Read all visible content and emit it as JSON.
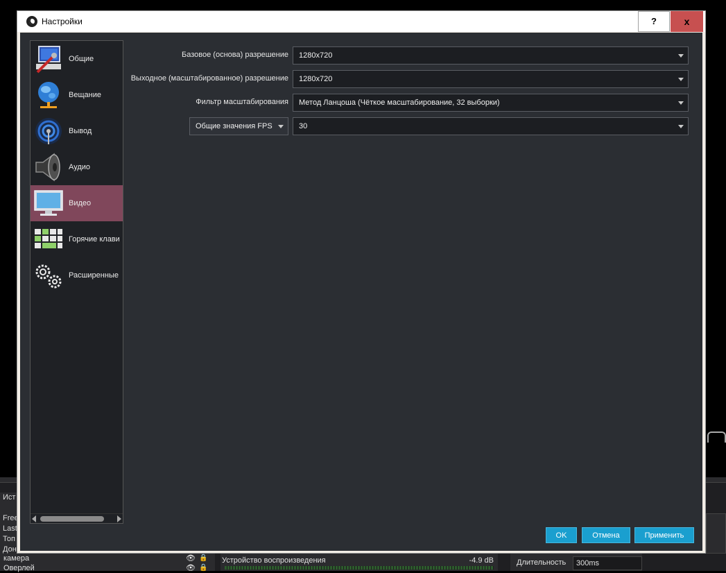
{
  "window": {
    "title": "Настройки",
    "help_label": "?",
    "close_label": "x"
  },
  "sidebar": {
    "items": [
      {
        "label": "Общие",
        "icon": "general-icon"
      },
      {
        "label": "Вещание",
        "icon": "globe-icon"
      },
      {
        "label": "Вывод",
        "icon": "output-signal-icon"
      },
      {
        "label": "Аудио",
        "icon": "speaker-icon"
      },
      {
        "label": "Видео",
        "icon": "monitor-icon",
        "active": true
      },
      {
        "label": "Горячие клави",
        "icon": "keyboard-icon"
      },
      {
        "label": "Расширенные",
        "icon": "gears-icon"
      }
    ]
  },
  "video": {
    "base_resolution_label": "Базовое (основа) разрешение",
    "base_resolution_value": "1280x720",
    "output_resolution_label": "Выходное (масштабированное) разрешение",
    "output_resolution_value": "1280x720",
    "scale_filter_label": "Фильтр масштабирования",
    "scale_filter_value": "Метод Ланцоша (Чёткое масштабирование, 32 выборки)",
    "fps_type_value": "Общие значения FPS",
    "fps_value": "30"
  },
  "buttons": {
    "ok": "OK",
    "cancel": "Отмена",
    "apply": "Применить"
  },
  "background": {
    "left_panel_label": "Ист",
    "left_panel_items": [
      "Free",
      "Last",
      "Топ",
      "Дон"
    ],
    "scenes": [
      "камера",
      "Оверлей"
    ],
    "mixer_label": "Устройство воспроизведения",
    "mixer_db": "-4.9 dB",
    "transition_duration_label": "Длительность",
    "transition_duration_value": "300ms"
  },
  "colors": {
    "active_nav": "#80475b",
    "accent_button": "#1a9fcf",
    "close_button": "#c75050"
  }
}
